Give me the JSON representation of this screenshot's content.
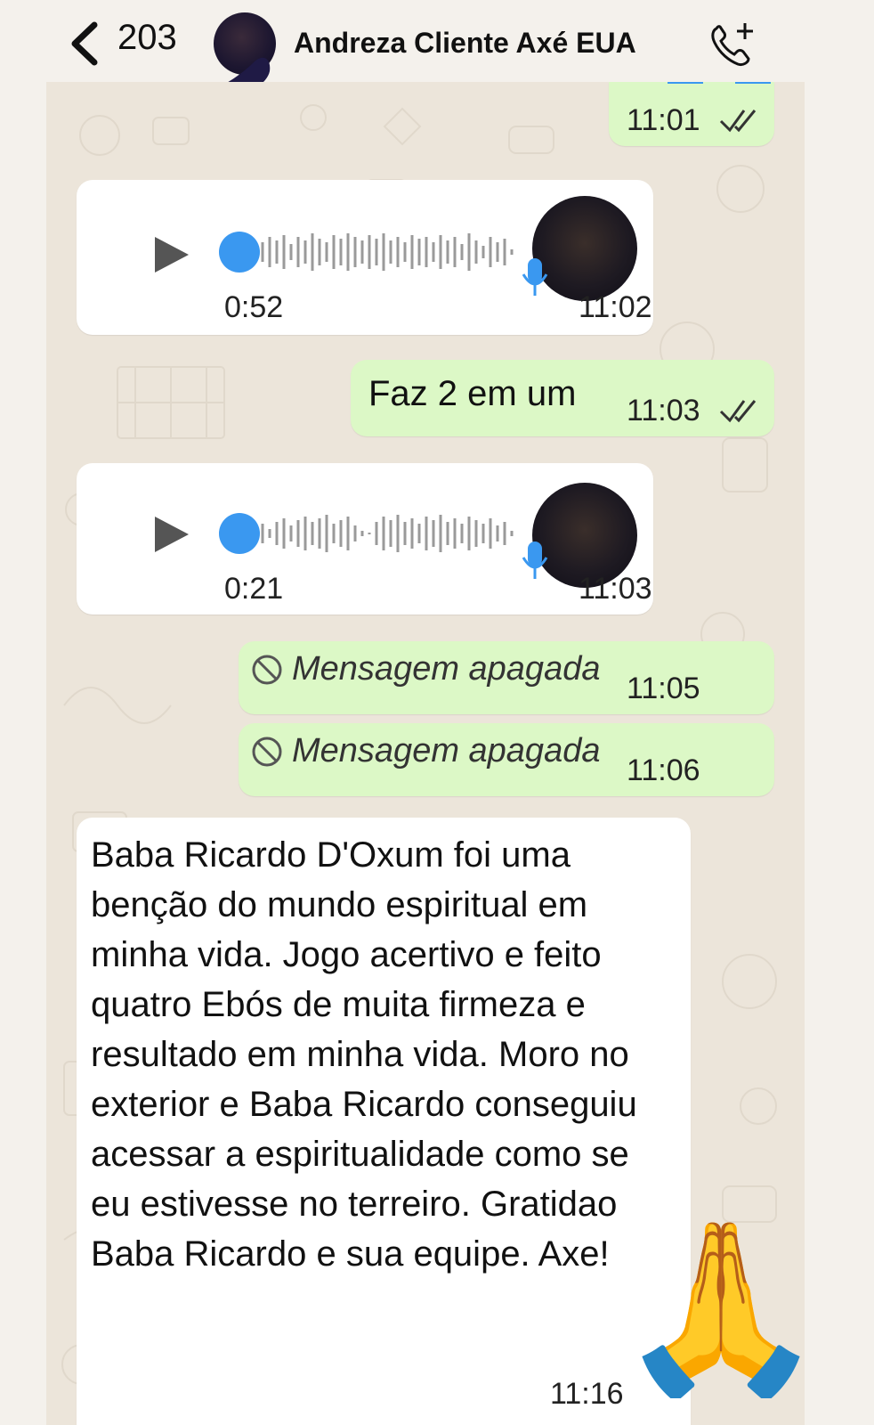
{
  "header": {
    "back_count": "203",
    "contact_name": "Andreza Cliente Axé EUA",
    "icons": [
      "chevron-left-icon",
      "avatar",
      "add-call-icon"
    ]
  },
  "colors": {
    "outgoing_bubble": "#dcf8c6",
    "incoming_bubble": "#ffffff",
    "chat_background": "#ece5da",
    "voice_accent": "#3a98f0"
  },
  "messages": [
    {
      "type": "outgoing-time-only",
      "time": "11:01",
      "status": "read"
    },
    {
      "type": "incoming-voice",
      "duration": "0:52",
      "time": "11:02"
    },
    {
      "type": "outgoing-text",
      "text": "Faz 2 em um",
      "time": "11:03",
      "status": "read"
    },
    {
      "type": "incoming-voice",
      "duration": "0:21",
      "time": "11:03"
    },
    {
      "type": "outgoing-deleted",
      "text": "Mensagem apagada",
      "time": "11:05"
    },
    {
      "type": "outgoing-deleted",
      "text": "Mensagem apagada",
      "time": "11:06"
    },
    {
      "type": "incoming-text",
      "text": "Baba Ricardo D'Oxum foi uma benção do mundo espiritual em minha vida. Jogo acertivo e feito quatro Ebós de muita firmeza e resultado em minha vida. Moro no exterior e Baba Ricardo conseguiu acessar a espiritualidade como se eu estivesse no terreiro. Gratidao Baba Ricardo e sua equipe. Axe!",
      "time": "11:16"
    }
  ],
  "overlay": {
    "emoji": "🙏"
  }
}
